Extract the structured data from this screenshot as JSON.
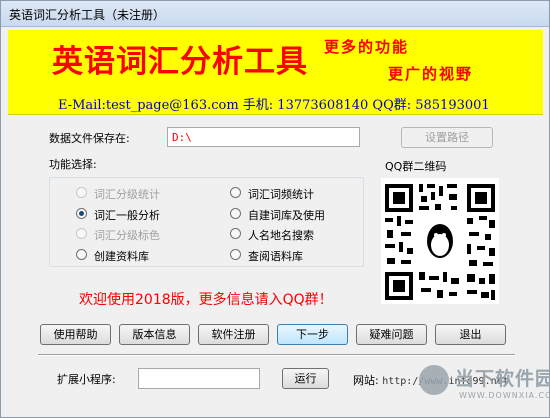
{
  "window": {
    "title": "英语词汇分析工具（未注册）"
  },
  "banner": {
    "title": "英语词汇分析工具",
    "slogan_1": "更多的功能",
    "slogan_2": "更广的视野",
    "contact": "E-Mail:test_page@163.com  手机: 13773608140  QQ群: 585193001",
    "color_background": "#ffff00",
    "color_title": "#ff0000",
    "color_contact": "#0000cc"
  },
  "data_path": {
    "label": "数据文件保存在:",
    "value": "D:\\",
    "set_button": "设置路径"
  },
  "functions": {
    "label": "功能选择:",
    "options": [
      {
        "label": "词汇分级统计",
        "selected": false,
        "enabled": false
      },
      {
        "label": "词汇词频统计",
        "selected": false,
        "enabled": true
      },
      {
        "label": "词汇一般分析",
        "selected": true,
        "enabled": true
      },
      {
        "label": "自建词库及使用",
        "selected": false,
        "enabled": true
      },
      {
        "label": "词汇分级标色",
        "selected": false,
        "enabled": false
      },
      {
        "label": "人名地名搜索",
        "selected": false,
        "enabled": true
      },
      {
        "label": "创建资料库",
        "selected": false,
        "enabled": true
      },
      {
        "label": "查阅语料库",
        "selected": false,
        "enabled": true
      }
    ]
  },
  "qr": {
    "caption": "QQ群二维码",
    "icon": "qq-penguin-icon"
  },
  "welcome": "欢迎使用2018版，更多信息请入QQ群！",
  "buttons": {
    "help": "使用帮助",
    "version": "版本信息",
    "register": "软件注册",
    "next": "下一步",
    "faq": "疑难问题",
    "exit": "退出"
  },
  "extension": {
    "label": "扩展小程序:",
    "value": "",
    "run_button": "运行"
  },
  "website": {
    "label": "网站:",
    "url": "http://www.infe99.net"
  },
  "watermark": {
    "name": "当下软件园",
    "url": "WWW.DOWNXIA.COM"
  }
}
